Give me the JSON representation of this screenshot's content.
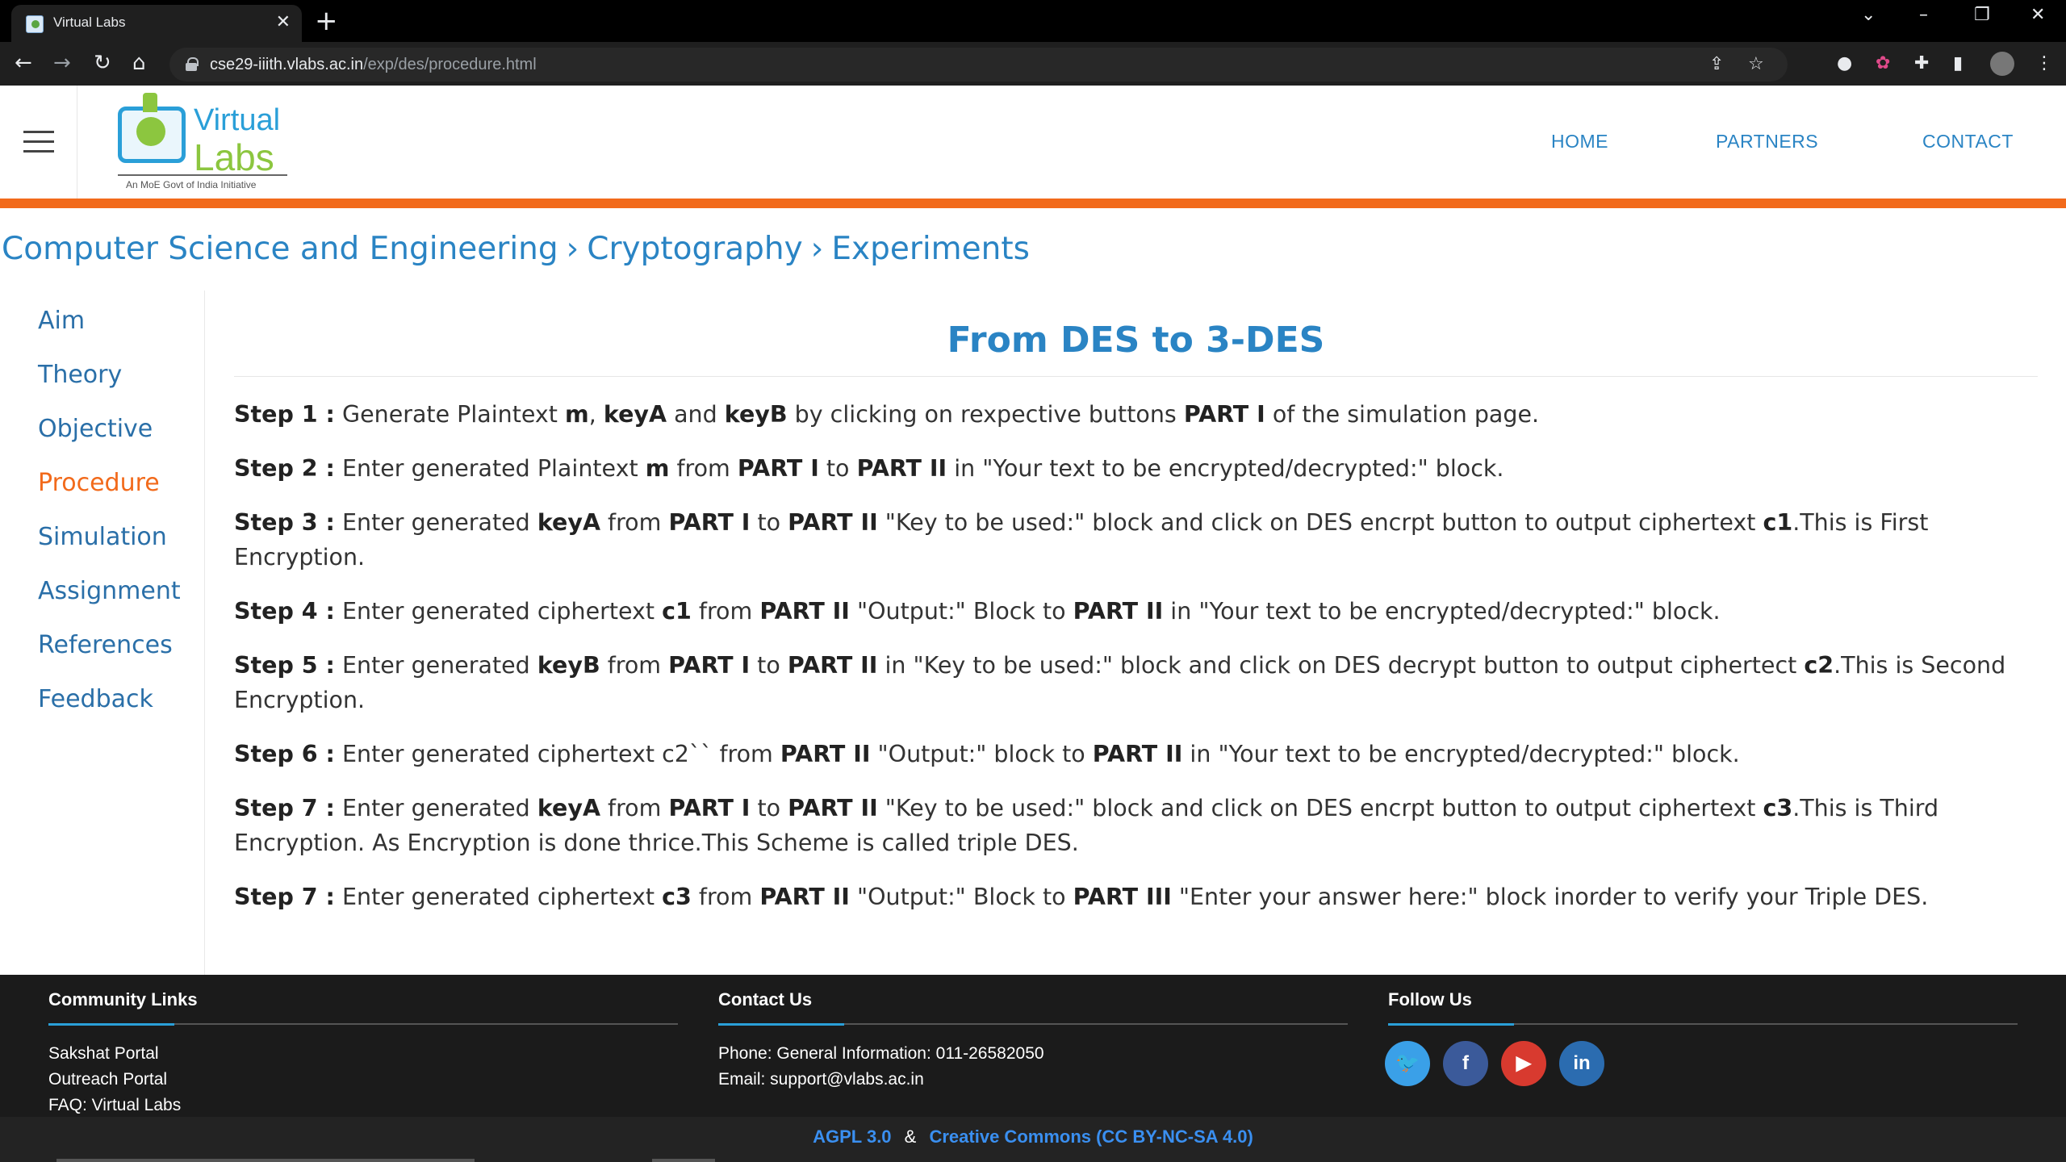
{
  "browser": {
    "tab_title": "Virtual Labs",
    "url_host": "cse29-iiith.vlabs.ac.in",
    "url_path": "/exp/des/procedure.html"
  },
  "header": {
    "logo_virtual": "Virtual",
    "logo_labs": "Labs",
    "logo_tagline": "An MoE Govt of India Initiative",
    "nav": [
      "HOME",
      "PARTNERS",
      "CONTACT"
    ]
  },
  "breadcrumb": [
    "Computer Science and Engineering",
    "Cryptography",
    "Experiments"
  ],
  "sidebar": {
    "items": [
      {
        "label": "Aim"
      },
      {
        "label": "Theory"
      },
      {
        "label": "Objective"
      },
      {
        "label": "Procedure",
        "active": true
      },
      {
        "label": "Simulation"
      },
      {
        "label": "Assignment"
      },
      {
        "label": "References"
      },
      {
        "label": "Feedback"
      }
    ]
  },
  "content": {
    "title": "From DES to 3-DES",
    "steps": [
      [
        {
          "b": "Step 1 :"
        },
        {
          "t": " Generate Plaintext "
        },
        {
          "b": "m"
        },
        {
          "t": ", "
        },
        {
          "b": "keyA"
        },
        {
          "t": " and "
        },
        {
          "b": "keyB"
        },
        {
          "t": " by clicking on rexpective buttons "
        },
        {
          "b": "PART I"
        },
        {
          "t": " of the simulation page."
        }
      ],
      [
        {
          "b": "Step 2 :"
        },
        {
          "t": " Enter generated Plaintext "
        },
        {
          "b": "m"
        },
        {
          "t": " from "
        },
        {
          "b": "PART I"
        },
        {
          "t": " to "
        },
        {
          "b": "PART II"
        },
        {
          "t": " in \"Your text to be encrypted/decrypted:\" block."
        }
      ],
      [
        {
          "b": "Step 3 :"
        },
        {
          "t": " Enter generated "
        },
        {
          "b": "keyA"
        },
        {
          "t": " from "
        },
        {
          "b": "PART I"
        },
        {
          "t": " to "
        },
        {
          "b": "PART II"
        },
        {
          "t": " \"Key to be used:\" block and click on DES encrpt button to output ciphertext "
        },
        {
          "b": "c1"
        },
        {
          "t": ".This is First Encryption."
        }
      ],
      [
        {
          "b": "Step 4 :"
        },
        {
          "t": " Enter generated ciphertext "
        },
        {
          "b": "c1"
        },
        {
          "t": " from "
        },
        {
          "b": "PART II"
        },
        {
          "t": " \"Output:\" Block to "
        },
        {
          "b": "PART II"
        },
        {
          "t": " in \"Your text to be encrypted/decrypted:\" block."
        }
      ],
      [
        {
          "b": "Step 5 :"
        },
        {
          "t": " Enter generated "
        },
        {
          "b": "keyB"
        },
        {
          "t": " from "
        },
        {
          "b": "PART I"
        },
        {
          "t": " to "
        },
        {
          "b": "PART II"
        },
        {
          "t": " in \"Key to be used:\" block and click on DES decrypt button to output ciphertect "
        },
        {
          "b": "c2"
        },
        {
          "t": ".This is Second Encryption."
        }
      ],
      [
        {
          "b": "Step 6 :"
        },
        {
          "t": " Enter generated ciphertext c2`` from "
        },
        {
          "b": "PART II"
        },
        {
          "t": " \"Output:\" block to "
        },
        {
          "b": "PART II"
        },
        {
          "t": " in \"Your text to be encrypted/decrypted:\" block."
        }
      ],
      [
        {
          "b": "Step 7 :"
        },
        {
          "t": " Enter generated "
        },
        {
          "b": "keyA"
        },
        {
          "t": " from "
        },
        {
          "b": "PART I"
        },
        {
          "t": " to "
        },
        {
          "b": "PART II"
        },
        {
          "t": " \"Key to be used:\" block and click on DES encrpt button to output ciphertext "
        },
        {
          "b": "c3"
        },
        {
          "t": ".This is Third Encryption. As Encryption is done thrice.This Scheme is called triple DES."
        }
      ],
      [
        {
          "b": "Step 7 :"
        },
        {
          "t": " Enter generated ciphertext "
        },
        {
          "b": "c3"
        },
        {
          "t": " from "
        },
        {
          "b": "PART II"
        },
        {
          "t": " \"Output:\" Block to "
        },
        {
          "b": "PART III"
        },
        {
          "t": " \"Enter your answer here:\" block inorder to verify your Triple DES."
        }
      ]
    ]
  },
  "footer": {
    "community": {
      "heading": "Community Links",
      "links": [
        "Sakshat Portal",
        "Outreach Portal",
        "FAQ: Virtual Labs"
      ]
    },
    "contact": {
      "heading": "Contact Us",
      "lines": [
        "Phone: General Information: 011-26582050",
        "Email: support@vlabs.ac.in"
      ]
    },
    "follow": {
      "heading": "Follow Us",
      "icons": [
        {
          "name": "twitter-icon",
          "glyph": "🐦",
          "color": "#3aa0e8"
        },
        {
          "name": "facebook-icon",
          "glyph": "f",
          "color": "#3b5a9a"
        },
        {
          "name": "youtube-icon",
          "glyph": "▶",
          "color": "#d83a2f"
        },
        {
          "name": "linkedin-icon",
          "glyph": "in",
          "color": "#2b6cb0"
        }
      ]
    },
    "license_agpl": "AGPL 3.0",
    "license_amp": "&",
    "license_cc": "Creative Commons (CC BY-NC-SA 4.0)"
  },
  "colors": {
    "accent_orange": "#f26a1b",
    "link_blue": "#2a84c4",
    "footer_bg": "#1b1b1b"
  }
}
